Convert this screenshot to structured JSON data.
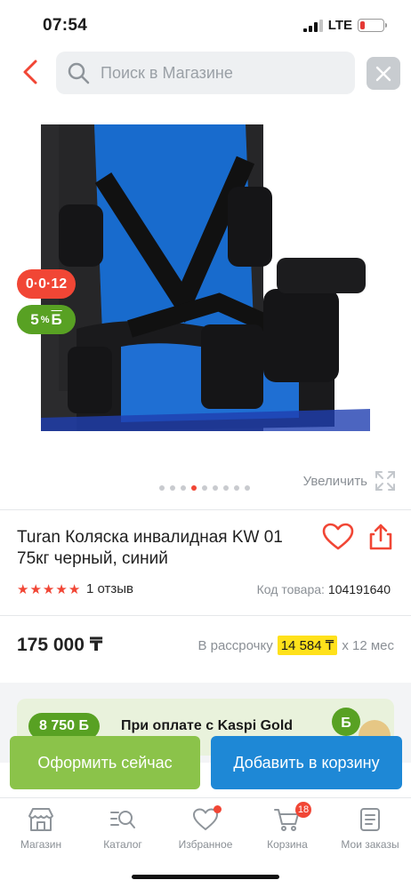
{
  "status_bar": {
    "time": "07:54",
    "network": "LTE",
    "battery_percent": 15
  },
  "header": {
    "search_placeholder": "Поиск в Магазине"
  },
  "product": {
    "badges": {
      "installment": "0·0·12",
      "bonus_value": "5",
      "bonus_suffix": "Б"
    },
    "gallery": {
      "dot_count": 9,
      "active_index": 3,
      "zoom_label": "Увеличить"
    },
    "title": "Turan Коляска инвалидная KW 01 75кг черный, синий",
    "rating_stars": 5,
    "reviews": "1 отзыв",
    "code_label": "Код товара:",
    "code_value": "104191640",
    "price": "175 000 ₸",
    "installment": {
      "label": "В рассрочку",
      "amount": "14 584 ₸",
      "term": "х 12 мес"
    }
  },
  "kaspi_gold": {
    "bonus": "8 750 Б",
    "text": "При оплате с Kaspi Gold"
  },
  "actions": {
    "order_now": "Оформить сейчас",
    "add_to_cart": "Добавить в корзину"
  },
  "tabbar": {
    "items": [
      {
        "label": "Магазин",
        "icon": "store-icon"
      },
      {
        "label": "Каталог",
        "icon": "catalog-search-icon"
      },
      {
        "label": "Избранное",
        "icon": "heart-icon"
      },
      {
        "label": "Корзина",
        "icon": "cart-icon",
        "count": "18"
      },
      {
        "label": "Мои заказы",
        "icon": "orders-icon"
      }
    ]
  },
  "colors": {
    "accent_red": "#f14635",
    "green": "#58a123",
    "blue": "#1e88d6",
    "light_green": "#8bc34a",
    "highlight": "#ffe11b"
  }
}
